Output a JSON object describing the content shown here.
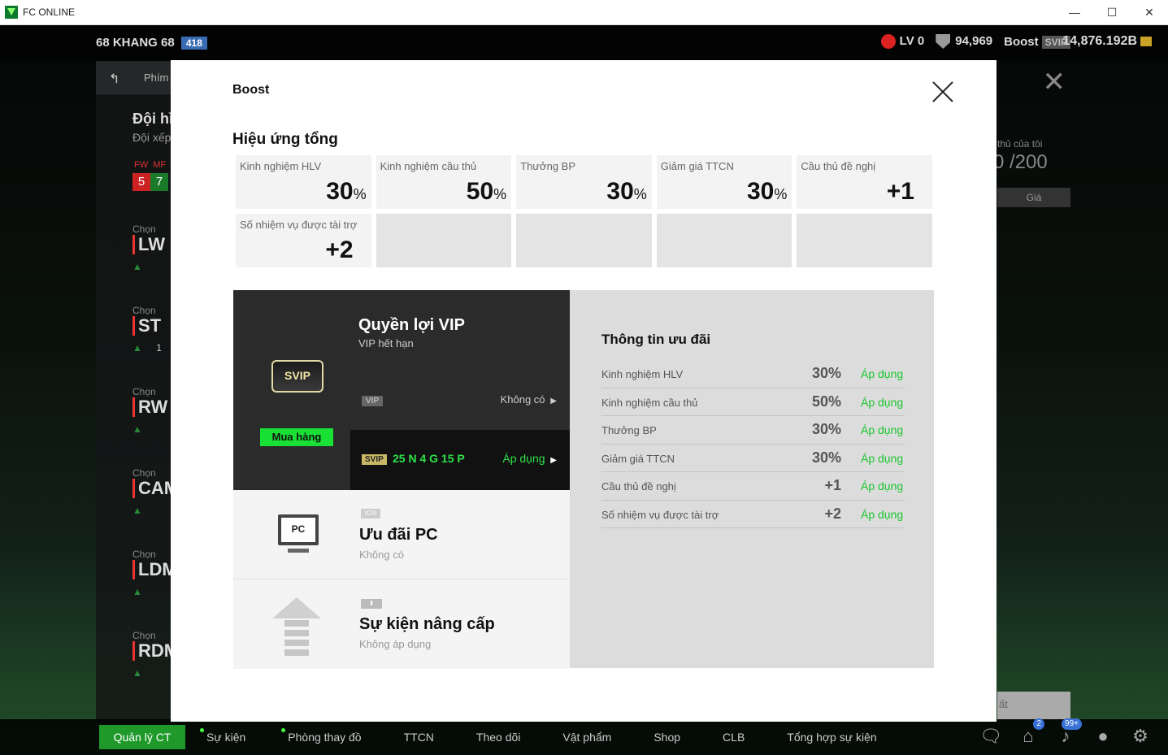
{
  "window": {
    "title": "FC ONLINE",
    "minimize": "—",
    "maximize": "☐",
    "close": "✕"
  },
  "topbar": {
    "player_name": "68 KHANG 68",
    "player_level": "418",
    "lv": "LV 0",
    "rank_points": "94,969",
    "boost_label": "Boost",
    "svip_tag": "SVIP",
    "coins": "14,876.192B"
  },
  "background": {
    "back_text": "Phím t",
    "lineup_title": "Đội hì",
    "lineup_sub": "Đội xếp",
    "fw_label": "FW",
    "mf_label": "MF",
    "fw_count": "5",
    "mf_count": "7",
    "slots": [
      {
        "label": "Chọn",
        "pos": "LW"
      },
      {
        "label": "Chọn",
        "pos": "ST"
      },
      {
        "label": "Chọn",
        "pos": "RW"
      },
      {
        "label": "Chọn",
        "pos": "CAM"
      },
      {
        "label": "Chọn",
        "pos": "LDM"
      },
      {
        "label": "Chọn",
        "pos": "RDM"
      }
    ],
    "st_count": "1",
    "right_text": "thủ của tôi",
    "right_count": "0 /200",
    "right_gia": "Giá",
    "right_btn_text": "ất"
  },
  "modal": {
    "title": "Boost",
    "section_title": "Hiệu ứng tổng",
    "effects": [
      {
        "label": "Kinh nghiệm HLV",
        "value": "30",
        "unit": "%"
      },
      {
        "label": "Kinh nghiệm cầu thủ",
        "value": "50",
        "unit": "%"
      },
      {
        "label": "Thưởng BP",
        "value": "30",
        "unit": "%"
      },
      {
        "label": "Giảm giá TTCN",
        "value": "30",
        "unit": "%"
      },
      {
        "label": "Cầu thủ đề nghị",
        "value": "+1",
        "unit": ""
      },
      {
        "label": "Số nhiệm vụ được tài trợ",
        "value": "+2",
        "unit": ""
      }
    ],
    "vip": {
      "badge": "SVIP",
      "buy_button": "Mua hàng",
      "title": "Quyền lợi VIP",
      "subtitle": "VIP hết hạn",
      "vip_chip": "VIP",
      "vip_status": "Không có",
      "svip_chip": "SVIP",
      "svip_time": "25 N 4 G 15 P",
      "svip_apply": "Áp dụng"
    },
    "pc": {
      "icon_text": "PC",
      "tag": "IGN",
      "title": "Ưu đãi PC",
      "subtitle": "Không có"
    },
    "upgrade": {
      "title": "Sự kiện nâng cấp",
      "subtitle": "Không áp dụng"
    },
    "info": {
      "title": "Thông tin ưu đãi",
      "rows": [
        {
          "label": "Kinh nghiệm HLV",
          "value": "30%",
          "action": "Áp dụng"
        },
        {
          "label": "Kinh nghiệm cầu thủ",
          "value": "50%",
          "action": "Áp dụng"
        },
        {
          "label": "Thưởng BP",
          "value": "30%",
          "action": "Áp dụng"
        },
        {
          "label": "Giảm giá TTCN",
          "value": "30%",
          "action": "Áp dụng"
        },
        {
          "label": "Cầu thủ đề nghị",
          "value": "+1",
          "action": "Áp dụng"
        },
        {
          "label": "Số nhiệm vụ được tài trợ",
          "value": "+2",
          "action": "Áp dụng"
        }
      ]
    }
  },
  "bottom_nav": {
    "tabs": [
      "Quản lý CT",
      "Sự kiện",
      "Phòng thay đồ",
      "TTCN",
      "Theo dõi",
      "Vật phẩm",
      "Shop",
      "CLB",
      "Tổng hợp sự kiện"
    ],
    "home_badge": "2",
    "bell_badge": "99+"
  }
}
